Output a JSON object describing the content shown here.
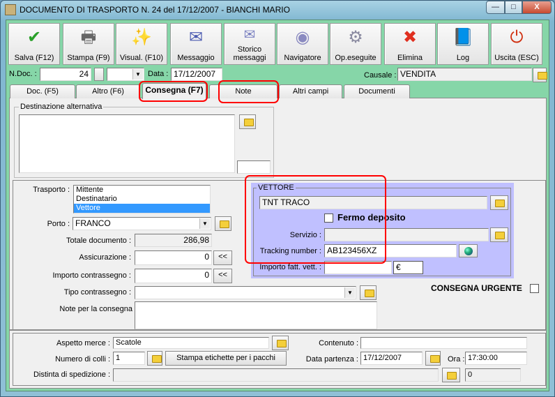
{
  "window": {
    "title": "DOCUMENTO DI TRASPORTO N. 24  del 17/12/2007 - BIANCHI MARIO",
    "minimize": "—",
    "maximize": "□",
    "close": "X"
  },
  "toolbar": [
    {
      "label": "Salva (F12)",
      "icon": "check-icon",
      "glyph": "✔",
      "color": "#2aa02a"
    },
    {
      "label": "Stampa (F9)",
      "icon": "printer-icon",
      "glyph": "🖶",
      "color": "#666"
    },
    {
      "label": "Visual. (F10)",
      "icon": "magic-wand-icon",
      "glyph": "✨",
      "color": "#d4a000"
    },
    {
      "label": "Messaggio",
      "icon": "envelope-pen-icon",
      "glyph": "✉",
      "color": "#4a5ab0"
    },
    {
      "label": "Storico\nmessaggi",
      "icon": "envelope-search-icon",
      "glyph": "✉",
      "color": "#7a80c0"
    },
    {
      "label": "Navigatore",
      "icon": "compass-icon",
      "glyph": "◉",
      "color": "#8a8ac0"
    },
    {
      "label": "Op.eseguite",
      "icon": "gears-search-icon",
      "glyph": "⚙",
      "color": "#8a8aa0"
    },
    {
      "label": "Elimina",
      "icon": "delete-x-icon",
      "glyph": "✖",
      "color": "#e03020"
    },
    {
      "label": "Log",
      "icon": "book-search-icon",
      "glyph": "📘",
      "color": "#2050c0"
    },
    {
      "label": "Uscita (ESC)",
      "icon": "power-icon",
      "glyph": "⏻",
      "color": "#d03010"
    }
  ],
  "header": {
    "ndoc_label": "N.Doc. :",
    "ndoc_value": "24",
    "series_value": "",
    "data_label": "Data :",
    "data_value": "17/12/2007",
    "causale_label": "Causale :",
    "causale_value": "VENDITA"
  },
  "tabs": [
    {
      "label": "Doc. (F5)"
    },
    {
      "label": "Altro (F6)"
    },
    {
      "label": "Consegna (F7)",
      "active": true
    },
    {
      "label": "Note"
    },
    {
      "label": "Altri campi"
    },
    {
      "label": "Documenti"
    }
  ],
  "destinazione": {
    "legend": "Destinazione alternativa",
    "value": "",
    "code": ""
  },
  "consegna": {
    "trasporto_label": "Trasporto :",
    "trasporto_options": [
      "Mittente",
      "Destinatario",
      "Vettore"
    ],
    "trasporto_selected": "Vettore",
    "porto_label": "Porto :",
    "porto_value": "FRANCO",
    "totale_label": "Totale documento :",
    "totale_value": "286,98",
    "assicurazione_label": "Assicurazione :",
    "assicurazione_value": "0",
    "contrassegno_label": "Importo contrassegno :",
    "contrassegno_value": "0",
    "copy_btn": "<<",
    "tipo_contrassegno_label": "Tipo contrassegno :",
    "tipo_contrassegno_value": "",
    "note_label": "Note per la consegna",
    "note_value": "",
    "urgente_label": "CONSEGNA URGENTE",
    "urgente_checked": false
  },
  "vettore": {
    "legend": "VETTORE",
    "name": "TNT TRACO",
    "fermo_label": "Fermo deposito",
    "fermo_checked": false,
    "servizio_label": "Servizio :",
    "servizio_value": "",
    "tracking_label": "Tracking number :",
    "tracking_value": "AB123456XZ",
    "importo_label": "Importo fatt. vett. :",
    "importo_value": "",
    "currency": "€"
  },
  "spedizione": {
    "aspetto_label": "Aspetto merce :",
    "aspetto_value": "Scatole",
    "contenuto_label": "Contenuto :",
    "contenuto_value": "",
    "colli_label": "Numero di colli :",
    "colli_value": "1",
    "stampa_etichette": "Stampa etichette per i pacchi",
    "partenza_label": "Data partenza :",
    "partenza_value": "17/12/2007",
    "ora_label": "Ora :",
    "ora_value": "17:30:00",
    "distinta_label": "Distinta di spedizione :",
    "distinta_value": "",
    "distinta_num": "0"
  },
  "colors": {
    "panel_green": "#86d6a8",
    "vettore_bg": "#c0c0ff",
    "highlight": "#f00",
    "selection": "#3399ff"
  }
}
